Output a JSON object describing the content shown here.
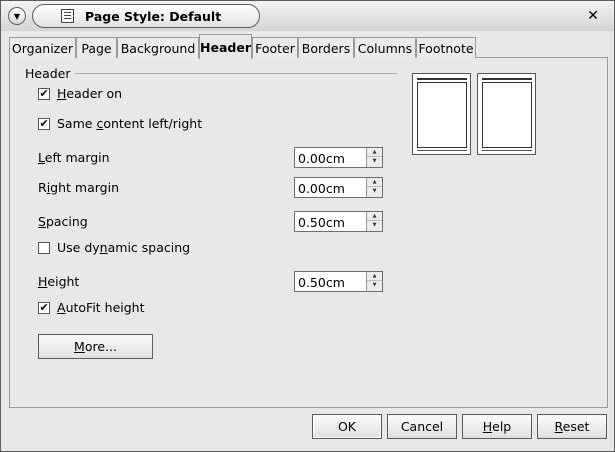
{
  "window": {
    "title": "Page Style: Default"
  },
  "tabs": [
    "Organizer",
    "Page",
    "Background",
    "Header",
    "Footer",
    "Borders",
    "Columns",
    "Footnote"
  ],
  "active_tab": "Header",
  "group": {
    "title": "Header"
  },
  "options": {
    "header_on": {
      "label_pre": "",
      "label_ul": "H",
      "label_post": "eader on",
      "checked": true
    },
    "same_content": {
      "label_pre": "Same ",
      "label_ul": "c",
      "label_post": "ontent left/right",
      "checked": true
    },
    "dynamic_spacing": {
      "label_pre": "Use dy",
      "label_ul": "n",
      "label_post": "amic spacing",
      "checked": false
    },
    "autofit": {
      "label_pre": "",
      "label_ul": "A",
      "label_post": "utoFit height",
      "checked": true
    }
  },
  "fields": {
    "left_margin": {
      "label_pre": "",
      "label_ul": "L",
      "label_post": "eft margin",
      "value": "0.00cm"
    },
    "right_margin": {
      "label_pre": "R",
      "label_ul": "i",
      "label_post": "ght margin",
      "value": "0.00cm"
    },
    "spacing": {
      "label_pre": "",
      "label_ul": "S",
      "label_post": "pacing",
      "value": "0.50cm"
    },
    "height": {
      "label_pre": "",
      "label_ul": "H",
      "label_post": "eight",
      "value": "0.50cm"
    }
  },
  "more_button": {
    "label_pre": "",
    "label_ul": "M",
    "label_post": "ore..."
  },
  "footer_buttons": {
    "ok": "OK",
    "cancel": "Cancel",
    "help": {
      "pre": "",
      "ul": "H",
      "post": "elp"
    },
    "reset": {
      "pre": "",
      "ul": "R",
      "post": "eset"
    }
  },
  "icons": {
    "menu": "chevron-down-icon",
    "close": "close-icon",
    "doc": "document-icon"
  }
}
